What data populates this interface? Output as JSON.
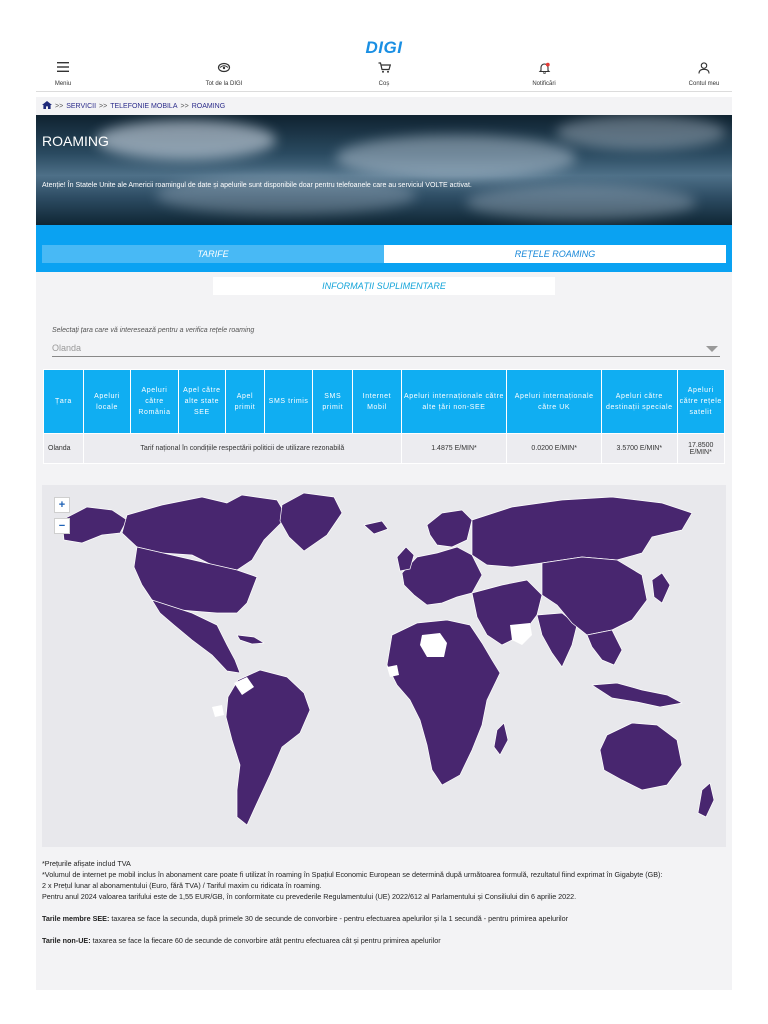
{
  "logo": "DIGI",
  "nav": [
    {
      "label": "Meniu",
      "icon": "menu-icon"
    },
    {
      "label": "Tot de la DIGI",
      "icon": "digi-icon"
    },
    {
      "label": "Coș",
      "icon": "cart-icon"
    },
    {
      "label": "Notificări",
      "icon": "bell-icon"
    },
    {
      "label": "Contul meu",
      "icon": "user-icon"
    }
  ],
  "breadcrumb": {
    "separator": ">>",
    "items": [
      "SERVICII",
      "TELEFONIE MOBILA",
      "ROAMING"
    ]
  },
  "hero": {
    "title": "ROAMING",
    "note": "Atenție! În Statele Unite ale Americii roamingul de date și apelurile sunt disponibile doar pentru telefoanele care au serviciul VOLTE activat."
  },
  "tabs": {
    "tarife": "TARIFE",
    "retele": "REȚELE ROAMING",
    "info": "INFORMAȚII SUPLIMENTARE"
  },
  "selector": {
    "label": "Selectați țara care vă interesează pentru a verifica rețele roaming",
    "value": "Olanda"
  },
  "table": {
    "headers": [
      "Țara",
      "Apeluri locale",
      "Apeluri către România",
      "Apel către alte state SEE",
      "Apel primit",
      "SMS trimis",
      "SMS primit",
      "Internet Mobil",
      "Apeluri internaționale către alte țări non-SEE",
      "Apeluri internaționale către UK",
      "Apeluri către destinații speciale",
      "Apeluri către rețele satelit"
    ],
    "row": {
      "country": "Olanda",
      "national": "Tarif național în condițiile respectării politicii de utilizare rezonabilă",
      "non_see": "1.4875 E/MIN*",
      "uk": "0.0200 E/MIN*",
      "special": "3.5700 E/MIN*",
      "satellite": "17.8500 E/MIN*"
    }
  },
  "map": {
    "zoom_in": "+",
    "zoom_out": "−",
    "land_color": "#48266f",
    "excluded_color": "#ffffff",
    "water_color": "#e8e8ec"
  },
  "footnotes": {
    "line1": "*Prețurile afișate includ TVA",
    "line2": "*Volumul de internet pe mobil inclus în abonament care poate fi utilizat în roaming în Spațiul Economic European se determină după următoarea formulă, rezultatul fiind exprimat în Gigabyte (GB):",
    "line3": "2 x Prețul lunar al abonamentului (Euro, fără TVA) / Tariful maxim cu ridicata în roaming.",
    "line4": "Pentru anul 2024 valoarea tarifului este de 1,55 EUR/GB, în conformitate cu prevederile Regulamentului (UE) 2022/612 al Parlamentului și Consiliului din 6 aprilie 2022.",
    "see_label": "Tarile membre SEE:",
    "see_text": " taxarea se face la secunda, după primele 30 de secunde de convorbire - pentru efectuarea apelurilor și la 1 secundă - pentru primirea apelurilor",
    "nonue_label": "Tarile non-UE:",
    "nonue_text": " taxarea se face la fiecare 60 de secunde de convorbire atât pentru efectuarea cât și pentru primirea apelurilor"
  }
}
